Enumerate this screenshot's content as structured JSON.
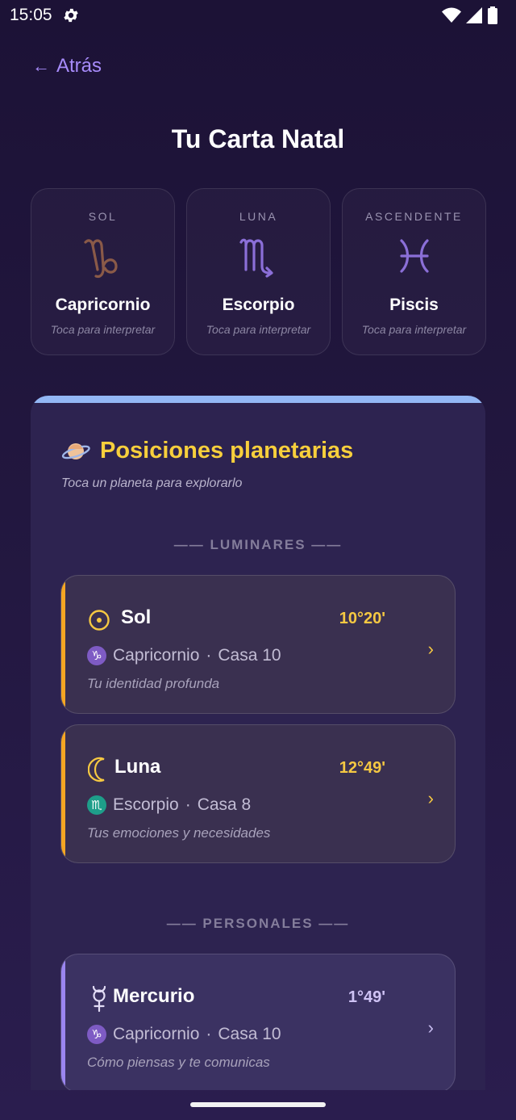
{
  "status": {
    "time": "15:05"
  },
  "nav": {
    "back_label": "Atrás",
    "back_arrow": "←"
  },
  "page": {
    "title": "Tu Carta Natal"
  },
  "big_three": [
    {
      "label": "SOL",
      "sign": "Capricornio",
      "hint": "Toca para interpretar",
      "glyph": "capricorn-icon",
      "color": "#8a5a48"
    },
    {
      "label": "LUNA",
      "sign": "Escorpio",
      "hint": "Toca para interpretar",
      "glyph": "scorpio-icon",
      "color": "#8b6fd8"
    },
    {
      "label": "ASCENDENTE",
      "sign": "Piscis",
      "hint": "Toca para interpretar",
      "glyph": "pisces-icon",
      "color": "#8b6fd8"
    }
  ],
  "panel": {
    "emoji": "planet-ringed-icon",
    "title": "Posiciones planetarias",
    "subtitle": "Toca un planeta para explorarlo",
    "accent_color": "#93b7f5"
  },
  "sections": [
    {
      "label": "—— LUMINARES ——"
    },
    {
      "label": "—— PERSONALES ——"
    }
  ],
  "planets": [
    {
      "name": "Sol",
      "degree": "10°20'",
      "sign": "Capricornio",
      "house": "Casa 10",
      "separator": "·",
      "description": "Tu identidad profunda",
      "icon": "sun-icon",
      "accent": "#f5a623",
      "sign_color": "#7e5bc4"
    },
    {
      "name": "Luna",
      "degree": "12°49'",
      "sign": "Escorpio",
      "house": "Casa 8",
      "separator": "·",
      "description": "Tus emociones y necesidades",
      "icon": "moon-icon",
      "accent": "#f5a623",
      "sign_color": "#1e9e8a"
    },
    {
      "name": "Mercurio",
      "degree": "1°49'",
      "sign": "Capricornio",
      "house": "Casa 10",
      "separator": "·",
      "description": "Cómo piensas y te comunicas",
      "icon": "mercury-icon",
      "accent": "#9b86f0",
      "sign_color": "#7e5bc4"
    }
  ],
  "chevron": "›"
}
